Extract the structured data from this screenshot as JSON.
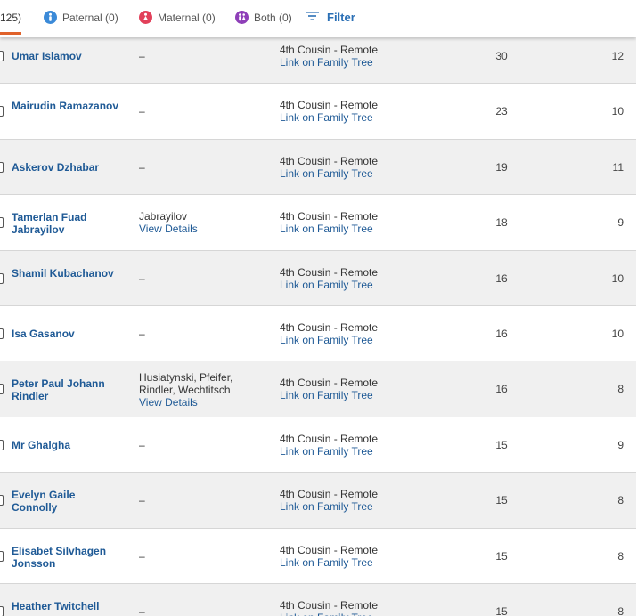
{
  "tabs": {
    "all_count": "125)",
    "paternal": "Paternal (0)",
    "maternal": "Maternal (0)",
    "both": "Both (0)",
    "filter": "Filter",
    "colors": {
      "paternal": "#3b8ad8",
      "maternal": "#e2405a",
      "both": "#8e3fb8",
      "active_underline": "#e0622b"
    }
  },
  "matches": [
    {
      "name": "Umar Islamov",
      "surnames": "–",
      "view_details": "",
      "relationship": "4th Cousin - Remote",
      "tree_link": "Link on Family Tree",
      "shared_cm": "30",
      "segments": "12"
    },
    {
      "name": "Mairudin Ramazanov",
      "surnames": "–",
      "view_details": "",
      "relationship": "4th Cousin - Remote",
      "tree_link": "Link on Family Tree",
      "shared_cm": "23",
      "segments": "10"
    },
    {
      "name": "Askerov Dzhabar",
      "surnames": "–",
      "view_details": "",
      "relationship": "4th Cousin - Remote",
      "tree_link": "Link on Family Tree",
      "shared_cm": "19",
      "segments": "11"
    },
    {
      "name": "Tamerlan Fuad Jabrayilov",
      "surnames": "Jabrayilov",
      "view_details": "View Details",
      "relationship": "4th Cousin - Remote",
      "tree_link": "Link on Family Tree",
      "shared_cm": "18",
      "segments": "9"
    },
    {
      "name": "Shamil Kubachanov",
      "surnames": "–",
      "view_details": "",
      "relationship": "4th Cousin - Remote",
      "tree_link": "Link on Family Tree",
      "shared_cm": "16",
      "segments": "10"
    },
    {
      "name": "Isa Gasanov",
      "surnames": "–",
      "view_details": "",
      "relationship": "4th Cousin - Remote",
      "tree_link": "Link on Family Tree",
      "shared_cm": "16",
      "segments": "10"
    },
    {
      "name": "Peter Paul Johann Rindler",
      "surnames": "Husiatynski, Pfeifer, Rindler, Wechtitsch",
      "view_details": "View Details",
      "relationship": "4th Cousin - Remote",
      "tree_link": "Link on Family Tree",
      "shared_cm": "16",
      "segments": "8"
    },
    {
      "name": "Mr Ghalgha",
      "surnames": "–",
      "view_details": "",
      "relationship": "4th Cousin - Remote",
      "tree_link": "Link on Family Tree",
      "shared_cm": "15",
      "segments": "9"
    },
    {
      "name": "Evelyn Gaile Connolly",
      "surnames": "–",
      "view_details": "",
      "relationship": "4th Cousin - Remote",
      "tree_link": "Link on Family Tree",
      "shared_cm": "15",
      "segments": "8"
    },
    {
      "name": "Elisabet Silvhagen Jonsson",
      "surnames": "–",
      "view_details": "",
      "relationship": "4th Cousin - Remote",
      "tree_link": "Link on Family Tree",
      "shared_cm": "15",
      "segments": "8"
    },
    {
      "name": "Heather Twitchell",
      "surnames": "–",
      "view_details": "",
      "relationship": "4th Cousin - Remote",
      "tree_link": "Link on Family Tree",
      "shared_cm": "15",
      "segments": "8"
    }
  ]
}
